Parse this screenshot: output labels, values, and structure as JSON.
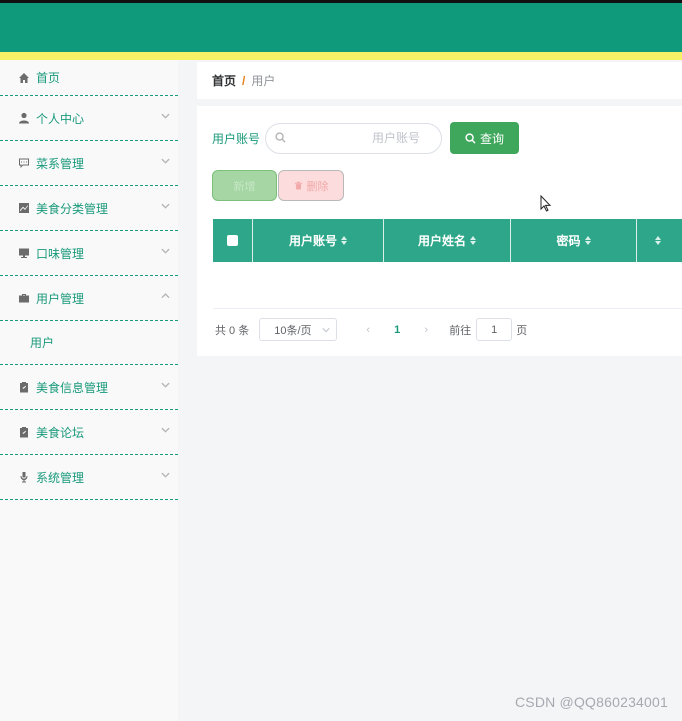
{
  "sidebar": {
    "items": [
      {
        "label": "首页",
        "icon": "home-icon"
      },
      {
        "label": "个人中心",
        "icon": "user-icon"
      },
      {
        "label": "菜系管理",
        "icon": "chat-icon"
      },
      {
        "label": "美食分类管理",
        "icon": "chart-icon"
      },
      {
        "label": "口味管理",
        "icon": "monitor-icon"
      },
      {
        "label": "用户管理",
        "icon": "briefcase-icon"
      },
      {
        "label": "美食信息管理",
        "icon": "clipboard-icon"
      },
      {
        "label": "美食论坛",
        "icon": "clipboard-icon"
      },
      {
        "label": "系统管理",
        "icon": "microphone-icon"
      }
    ],
    "sub_item": "用户"
  },
  "breadcrumb": {
    "home": "首页",
    "separator": "/",
    "current": "用户"
  },
  "search": {
    "label": "用户账号",
    "placeholder": "用户账号",
    "value": "",
    "button": "查询"
  },
  "actions": {
    "add": "新增",
    "delete": "删除"
  },
  "table": {
    "columns": [
      "用户账号",
      "用户姓名",
      "密码"
    ]
  },
  "pagination": {
    "total": "共 0 条",
    "page_size": "10条/页",
    "current_page": "1",
    "goto_label": "前往",
    "goto_value": "1",
    "page_unit": "页"
  },
  "watermark": "CSDN @QQ860234001",
  "colors": {
    "header": "#0e9a7b",
    "stripe": "#f6f165",
    "accent": "#1a9a7b",
    "table_head": "#2ea689",
    "query_button": "#3fa75c"
  }
}
